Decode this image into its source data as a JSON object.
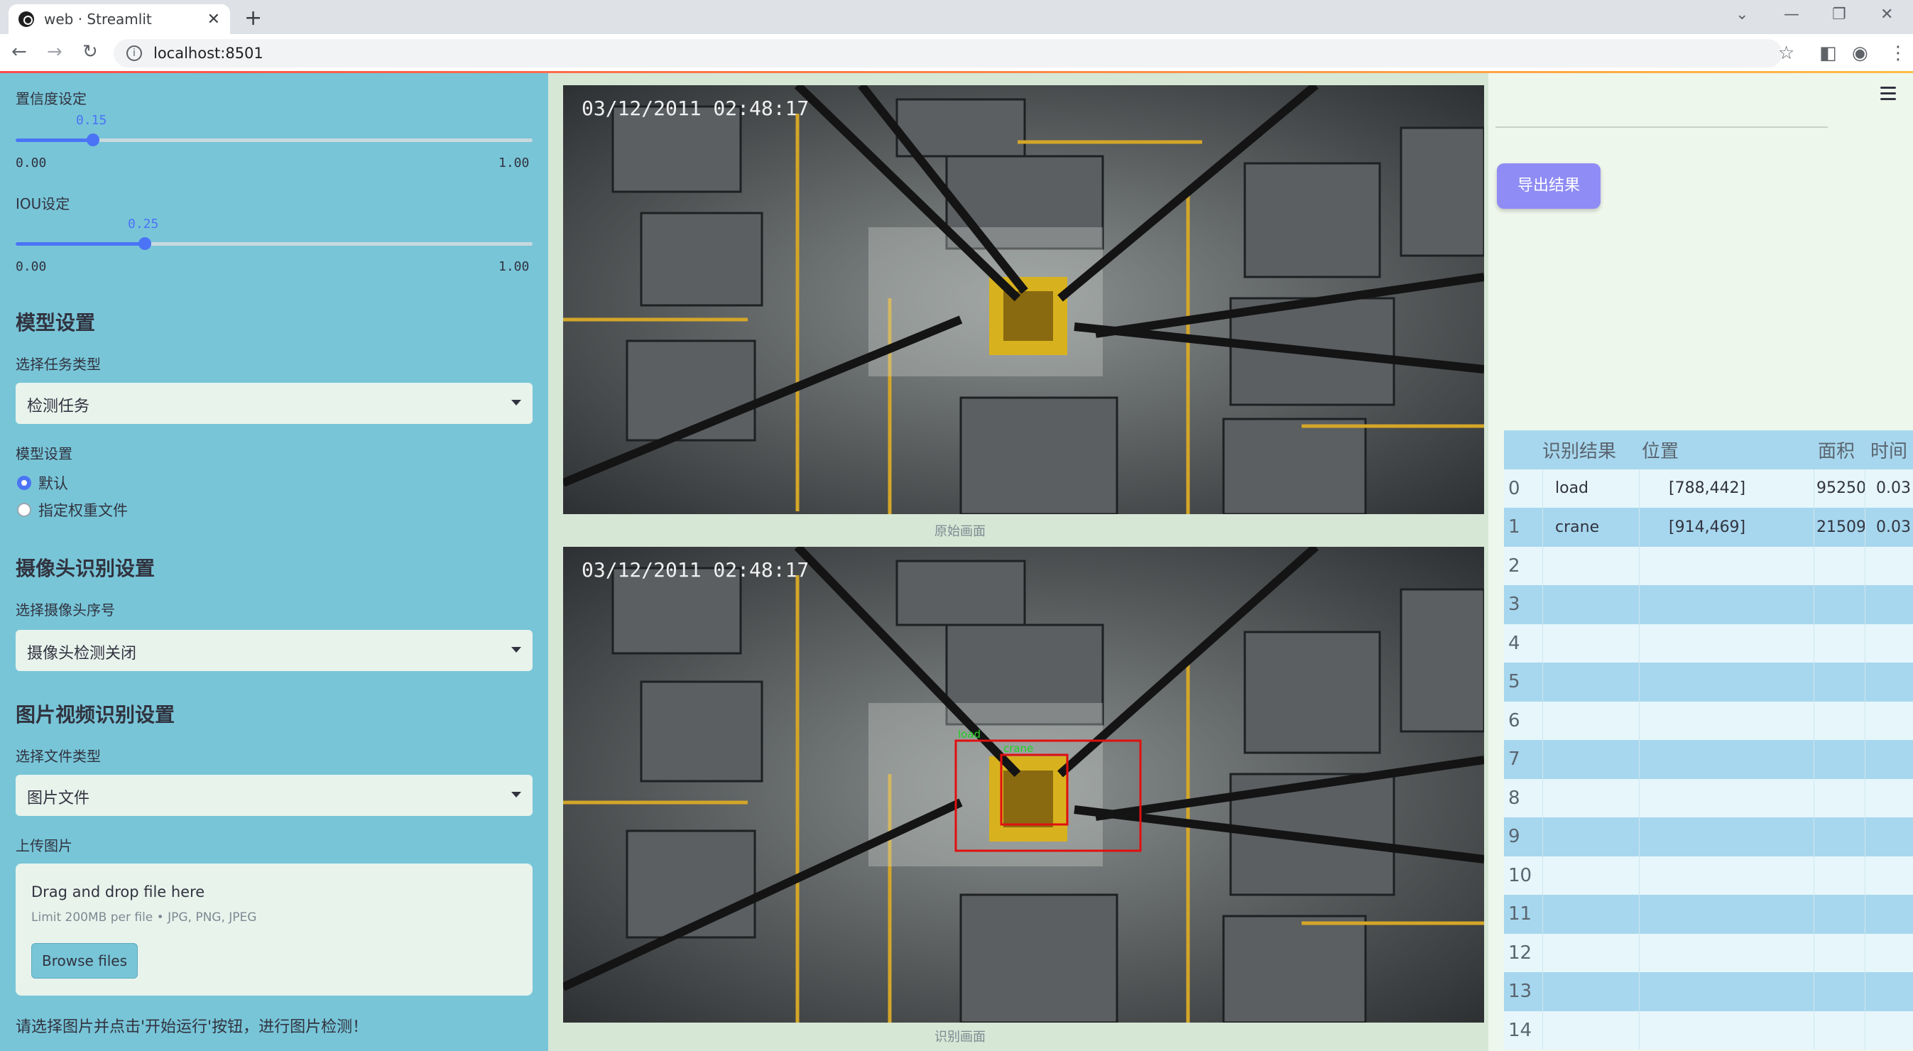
{
  "browser": {
    "tab_title": "web · Streamlit",
    "tab_close": "✕",
    "new_tab": "+",
    "url": "localhost:8501",
    "window_controls": [
      "⌄",
      "—",
      "❐",
      "✕"
    ]
  },
  "sidebar": {
    "confidence": {
      "label": "置信度设定",
      "value": "0.15",
      "min": "0.00",
      "max": "1.00",
      "fraction": 0.15
    },
    "iou": {
      "label": "IOU设定",
      "value": "0.25",
      "min": "0.00",
      "max": "1.00",
      "fraction": 0.25
    },
    "model_heading": "模型设置",
    "task_type_label": "选择任务类型",
    "task_type_value": "检测任务",
    "model_setting_label": "模型设置",
    "model_options": [
      {
        "label": "默认",
        "selected": true
      },
      {
        "label": "指定权重文件",
        "selected": false
      }
    ],
    "camera_heading": "摄像头识别设置",
    "camera_label": "选择摄像头序号",
    "camera_value": "摄像头检测关闭",
    "media_heading": "图片视频识别设置",
    "file_type_label": "选择文件类型",
    "file_type_value": "图片文件",
    "upload_label": "上传图片",
    "upload": {
      "drop_text": "Drag and drop file here",
      "limit_text": "Limit 200MB per file • JPG, PNG, JPEG",
      "browse_label": "Browse files"
    },
    "hint": "请选择图片并点击'开始运行'按钮，进行图片检测！"
  },
  "main": {
    "original": {
      "timestamp": "03/12/2011  02:48:17",
      "caption": "原始画面"
    },
    "detected": {
      "timestamp": "03/12/2011  02:48:17",
      "caption": "识别画面",
      "box_labels": [
        "load",
        "crane"
      ]
    },
    "export_label": "导出结果"
  },
  "table": {
    "headers": [
      "识别结果",
      "位置",
      "面积",
      "时间"
    ],
    "rows": [
      {
        "idx": "0",
        "result": "load",
        "position": "[788,442]",
        "area": "95250",
        "time": "0.03"
      },
      {
        "idx": "1",
        "result": "crane",
        "position": "[914,469]",
        "area": "21509",
        "time": "0.03"
      },
      {
        "idx": "2",
        "result": "",
        "position": "",
        "area": "",
        "time": ""
      },
      {
        "idx": "3",
        "result": "",
        "position": "",
        "area": "",
        "time": ""
      },
      {
        "idx": "4",
        "result": "",
        "position": "",
        "area": "",
        "time": ""
      },
      {
        "idx": "5",
        "result": "",
        "position": "",
        "area": "",
        "time": ""
      },
      {
        "idx": "6",
        "result": "",
        "position": "",
        "area": "",
        "time": ""
      },
      {
        "idx": "7",
        "result": "",
        "position": "",
        "area": "",
        "time": ""
      },
      {
        "idx": "8",
        "result": "",
        "position": "",
        "area": "",
        "time": ""
      },
      {
        "idx": "9",
        "result": "",
        "position": "",
        "area": "",
        "time": ""
      },
      {
        "idx": "10",
        "result": "",
        "position": "",
        "area": "",
        "time": ""
      },
      {
        "idx": "11",
        "result": "",
        "position": "",
        "area": "",
        "time": ""
      },
      {
        "idx": "12",
        "result": "",
        "position": "",
        "area": "",
        "time": ""
      },
      {
        "idx": "13",
        "result": "",
        "position": "",
        "area": "",
        "time": ""
      },
      {
        "idx": "14",
        "result": "",
        "position": "",
        "area": "",
        "time": ""
      }
    ]
  },
  "colors": {
    "sidebar_bg": "#78c5d8",
    "accent": "#4a74f5",
    "export_button": "#8f8cf5",
    "detect_box": "#e01010",
    "table_stripe": "#a7d7ee"
  },
  "icons": [
    "streamlit-favicon",
    "back-arrow-icon",
    "forward-arrow-icon",
    "reload-icon",
    "info-icon",
    "star-icon",
    "sidepanel-icon",
    "profile-icon",
    "kebab-menu-icon",
    "hamburger-menu-icon",
    "caret-down-icon"
  ]
}
